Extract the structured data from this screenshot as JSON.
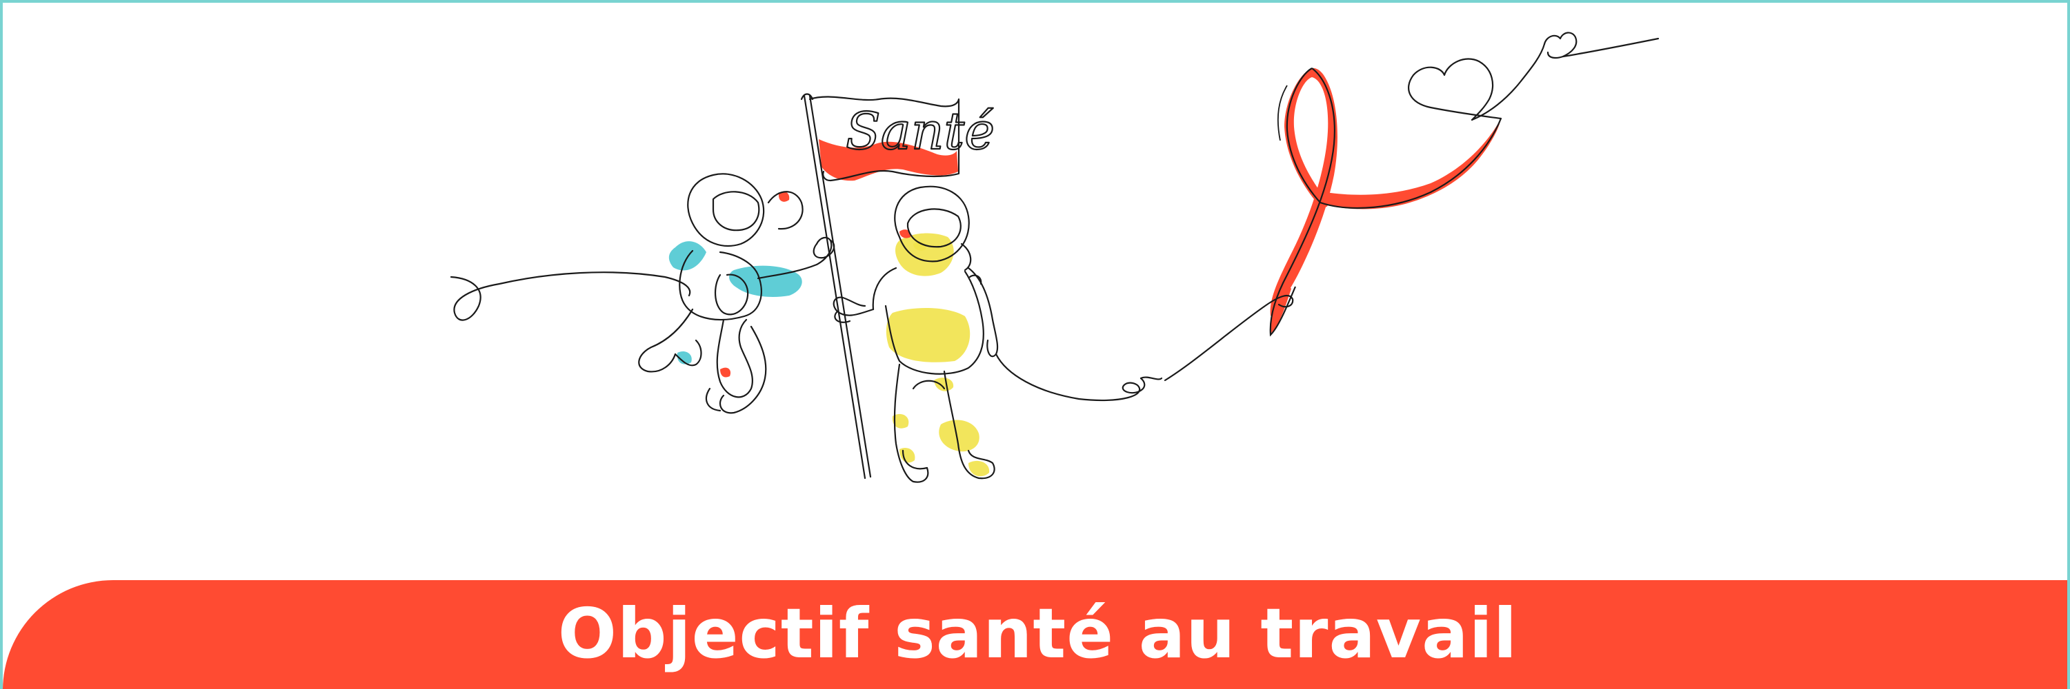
{
  "banner": {
    "title": "Objectif santé au travail",
    "background_color": "#ff4b32",
    "text_color": "#ffffff"
  },
  "illustration": {
    "flag_text": "Santé",
    "line_color": "#1a1a1a",
    "accent_colors": {
      "cyan": "#4ec8d2",
      "yellow": "#f1e24a",
      "red": "#ff4b32"
    },
    "frame_border_color": "#79d3d1"
  }
}
